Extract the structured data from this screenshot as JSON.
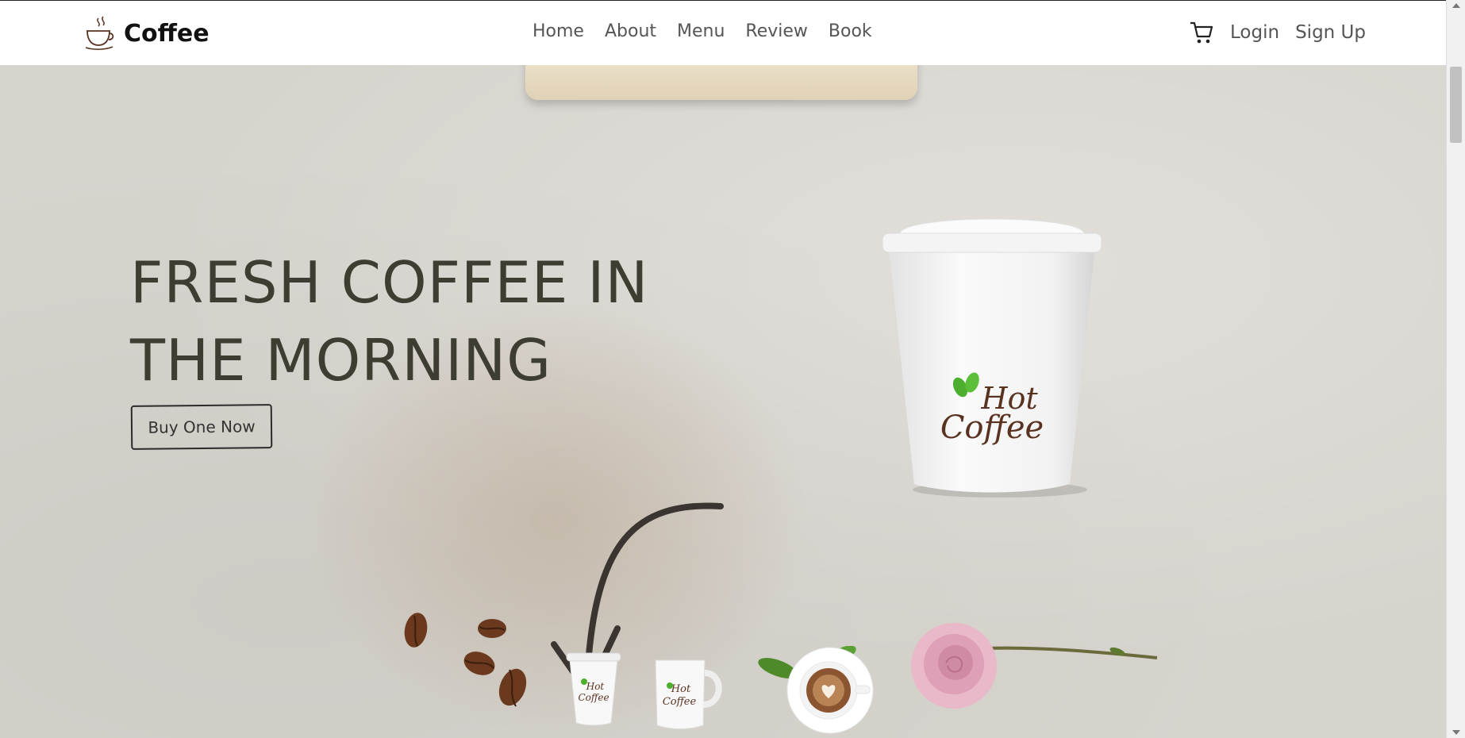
{
  "navbar": {
    "brand": "Coffee",
    "links": [
      "Home",
      "About",
      "Menu",
      "Review",
      "Book"
    ],
    "login": "Login",
    "signup": "Sign Up"
  },
  "hero": {
    "headline_line1": "FRESH COFFEE IN",
    "headline_line2": "THE MORNING",
    "cta": "Buy One Now",
    "cup_logo_line1": "Hot",
    "cup_logo_line2": "Coffee"
  },
  "colors": {
    "heading": "#3d3d31",
    "background": "#d7d4ce",
    "navbar": "#ffffff",
    "logo_brown": "#5a3220",
    "logo_green": "#4caf2e"
  },
  "icons": [
    "coffee-cup-icon",
    "cart-icon"
  ]
}
